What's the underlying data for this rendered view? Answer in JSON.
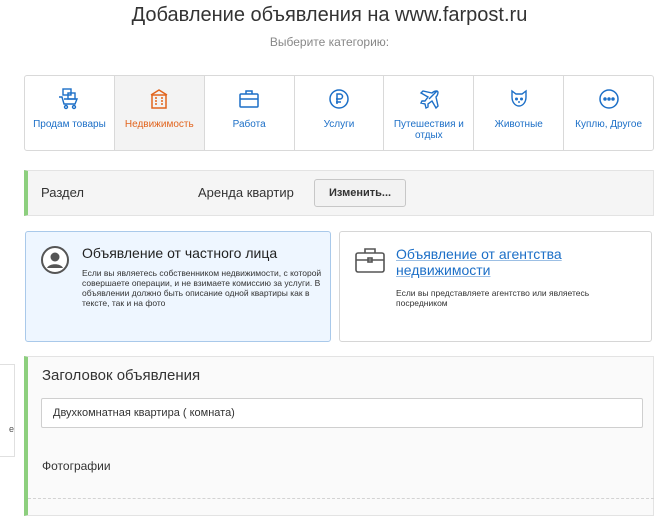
{
  "header": {
    "title": "Добавление объявления на www.farpost.ru",
    "subtitle": "Выберите категорию:"
  },
  "categories": [
    {
      "label": "Продам товары",
      "icon": "cart-boxes-icon"
    },
    {
      "label": "Недвижимость",
      "icon": "building-icon",
      "active": true
    },
    {
      "label": "Работа",
      "icon": "briefcase-icon"
    },
    {
      "label": "Услуги",
      "icon": "ruble-coin-icon"
    },
    {
      "label": "Путешествия и отдых",
      "icon": "airplane-icon"
    },
    {
      "label": "Животные",
      "icon": "cat-icon"
    },
    {
      "label": "Куплю, Другое",
      "icon": "more-dots-icon"
    }
  ],
  "section": {
    "label": "Раздел",
    "value": "Аренда квартир",
    "change_button": "Изменить..."
  },
  "owner_type": {
    "private": {
      "title": "Объявление от частного лица",
      "description": "Если вы являетесь собственником недвижимости, с которой совершаете операции, и не взимаете комиссию за услуги. В объявлении должно быть описание одной квартиры как в тексте, так и на фото"
    },
    "agency": {
      "title": "Объявление от агентства недвижимости",
      "description": "Если вы представляете агентство или являетесь посредником"
    }
  },
  "form": {
    "heading": "Заголовок объявления",
    "title_value": "Двухкомнатная квартира ( комната)",
    "photos_label": "Фотографии"
  },
  "side_tip": {
    "text": "е"
  },
  "colors": {
    "link": "#1c6fc7",
    "active": "#e2641d",
    "accent_green": "#8dcf7e"
  }
}
